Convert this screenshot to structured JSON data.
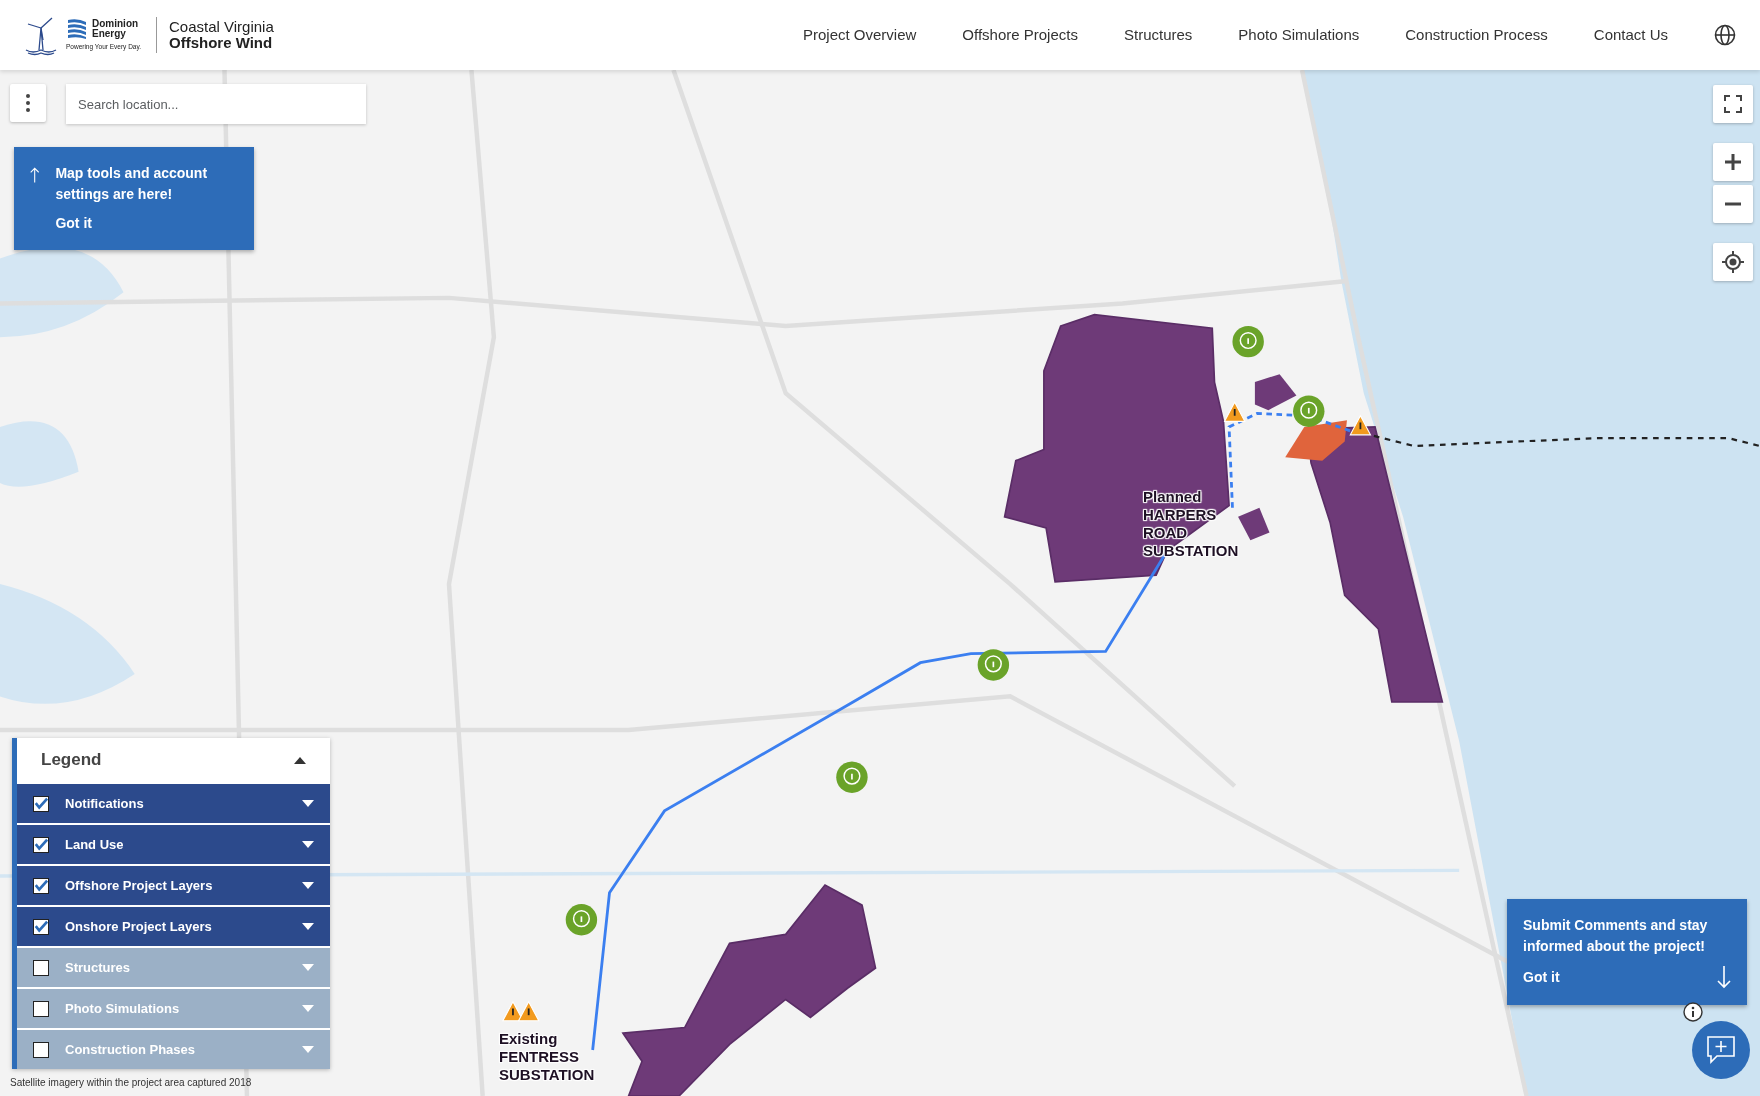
{
  "header": {
    "brand": {
      "company": "Dominion Energy",
      "tagline": "Powering Your Every Day.",
      "project_line1": "Coastal Virginia",
      "project_line2": "Offshore Wind"
    },
    "nav": [
      "Project Overview",
      "Offshore Projects",
      "Structures",
      "Photo Simulations",
      "Construction Process",
      "Contact Us"
    ]
  },
  "map": {
    "search": {
      "placeholder": "Search location..."
    },
    "tools_tip": {
      "text": "Map tools and account settings are here!",
      "action": "Got it"
    },
    "labels": [
      {
        "kind": "planned",
        "lines": [
          "Planned",
          "HARPERS",
          "ROAD",
          "SUBSTATION"
        ]
      },
      {
        "kind": "existing",
        "lines": [
          "Existing",
          "FENTRESS",
          "SUBSTATION"
        ]
      }
    ],
    "legend": {
      "title": "Legend",
      "expanded": true,
      "layers": [
        {
          "label": "Notifications",
          "checked": true
        },
        {
          "label": "Land Use",
          "checked": true
        },
        {
          "label": "Offshore Project Layers",
          "checked": true
        },
        {
          "label": "Onshore Project Layers",
          "checked": true
        },
        {
          "label": "Structures",
          "checked": false
        },
        {
          "label": "Photo Simulations",
          "checked": false
        },
        {
          "label": "Construction Phases",
          "checked": false
        }
      ]
    },
    "attribution": "Satellite imagery within the project area captured 2018",
    "comment_tip": {
      "text": "Submit Comments and stay informed about the project!",
      "action": "Got it"
    }
  }
}
